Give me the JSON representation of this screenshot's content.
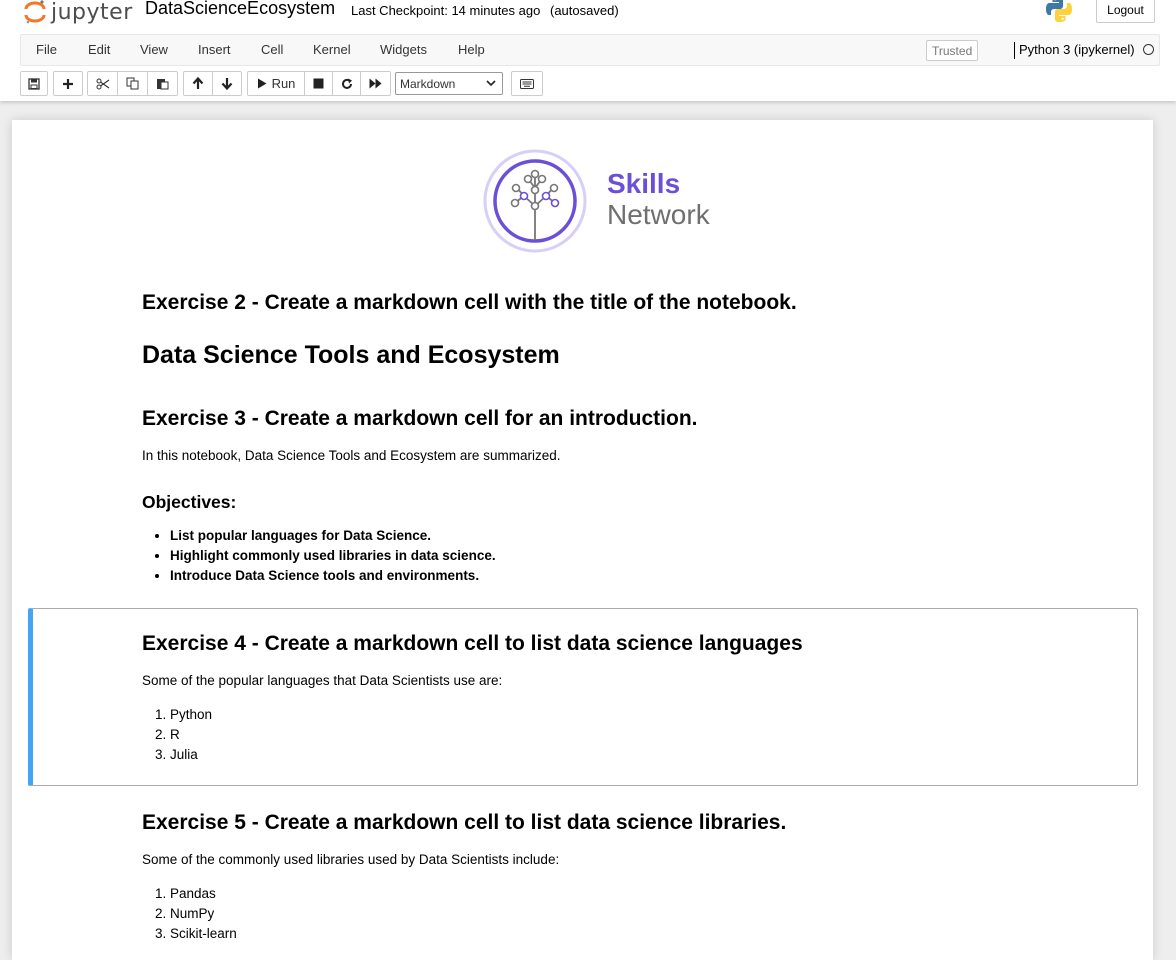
{
  "header": {
    "logo_text": "jupyter",
    "notebook_name": "DataScienceEcosystem",
    "checkpoint": "Last Checkpoint: 14 minutes ago",
    "autosave": "(autosaved)",
    "logout_label": "Logout",
    "brand_color": "#f37726"
  },
  "menu": {
    "items": [
      "File",
      "Edit",
      "View",
      "Insert",
      "Cell",
      "Kernel",
      "Widgets",
      "Help"
    ],
    "trusted": "Trusted",
    "kernel_name": "Python 3 (ipykernel)"
  },
  "toolbar": {
    "run_label": "Run",
    "cell_type": "Markdown",
    "icons": [
      "save-icon",
      "plus-icon",
      "cut-icon",
      "copy-icon",
      "paste-icon",
      "arrow-up-icon",
      "arrow-down-icon",
      "run-icon",
      "stop-icon",
      "restart-icon",
      "fast-forward-icon",
      "keyboard-icon"
    ]
  },
  "notebook": {
    "banner": {
      "line1": "Skills",
      "line2": "Network",
      "color_purple": "#6b4fd8",
      "color_gray": "#6f6f6f"
    },
    "ex2_heading": "Exercise 2 - Create a markdown cell with the title of the notebook.",
    "title": "Data Science Tools and Ecosystem",
    "ex3_heading": "Exercise 3 - Create a markdown cell for an introduction.",
    "intro": "In this notebook, Data Science Tools and Ecosystem are summarized.",
    "objectives_heading": "Objectives:",
    "objectives": [
      "List popular languages for Data Science.",
      "Highlight commonly used libraries in data science.",
      "Introduce Data Science tools and environments."
    ],
    "ex4_heading": "Exercise 4 - Create a markdown cell to list data science languages",
    "languages_intro": "Some of the popular languages that Data Scientists use are:",
    "languages": [
      "Python",
      "R",
      "Julia"
    ],
    "ex5_heading": "Exercise 5 - Create a markdown cell to list data science libraries.",
    "libraries_intro": "Some of the commonly used libraries used by Data Scientists include:",
    "libraries": [
      "Pandas",
      "NumPy",
      "Scikit-learn"
    ],
    "selected_color": "#42a5f5"
  }
}
